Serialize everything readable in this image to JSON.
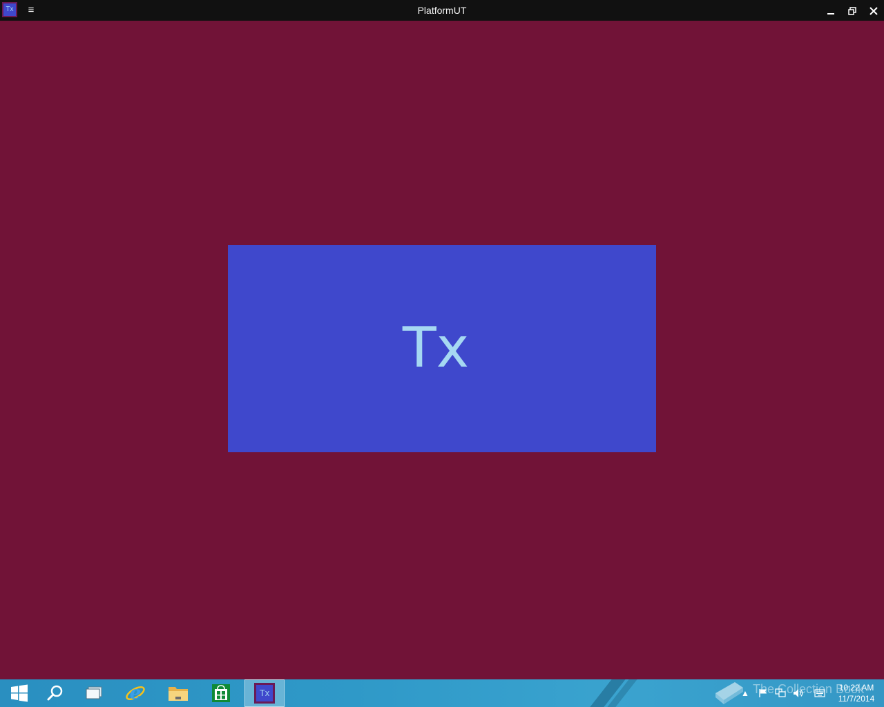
{
  "window": {
    "title": "PlatformUT",
    "app_icon_text": "Tx",
    "menu_icon": "hamburger-menu-icon",
    "controls": {
      "minimize_icon": "minimize-icon",
      "maximize_icon": "restore-icon",
      "close_icon": "close-icon"
    }
  },
  "content": {
    "background_color": "#711337",
    "splash": {
      "text": "Tx",
      "background_color": "#3f48cc",
      "text_color": "#a6d8f2"
    }
  },
  "taskbar": {
    "background_color": "#2f99c8",
    "buttons": [
      {
        "name": "start-button",
        "icon": "windows-logo-icon"
      },
      {
        "name": "search-button",
        "icon": "search-icon"
      },
      {
        "name": "task-view-button",
        "icon": "task-view-icon"
      },
      {
        "name": "internet-explorer-button",
        "icon": "internet-explorer-icon"
      },
      {
        "name": "file-explorer-button",
        "icon": "folder-icon"
      },
      {
        "name": "store-button",
        "icon": "store-icon"
      },
      {
        "name": "platformut-taskbar-button",
        "icon": "tx-app-icon",
        "label": "Tx",
        "active": true
      }
    ],
    "tray": {
      "icons": [
        "show-hidden-icons-icon",
        "action-center-flag-icon",
        "network-icon",
        "volume-icon",
        "keyboard-icon"
      ],
      "watermark": "The Collection Book",
      "time": "10:22 AM",
      "date": "11/7/2014"
    }
  }
}
